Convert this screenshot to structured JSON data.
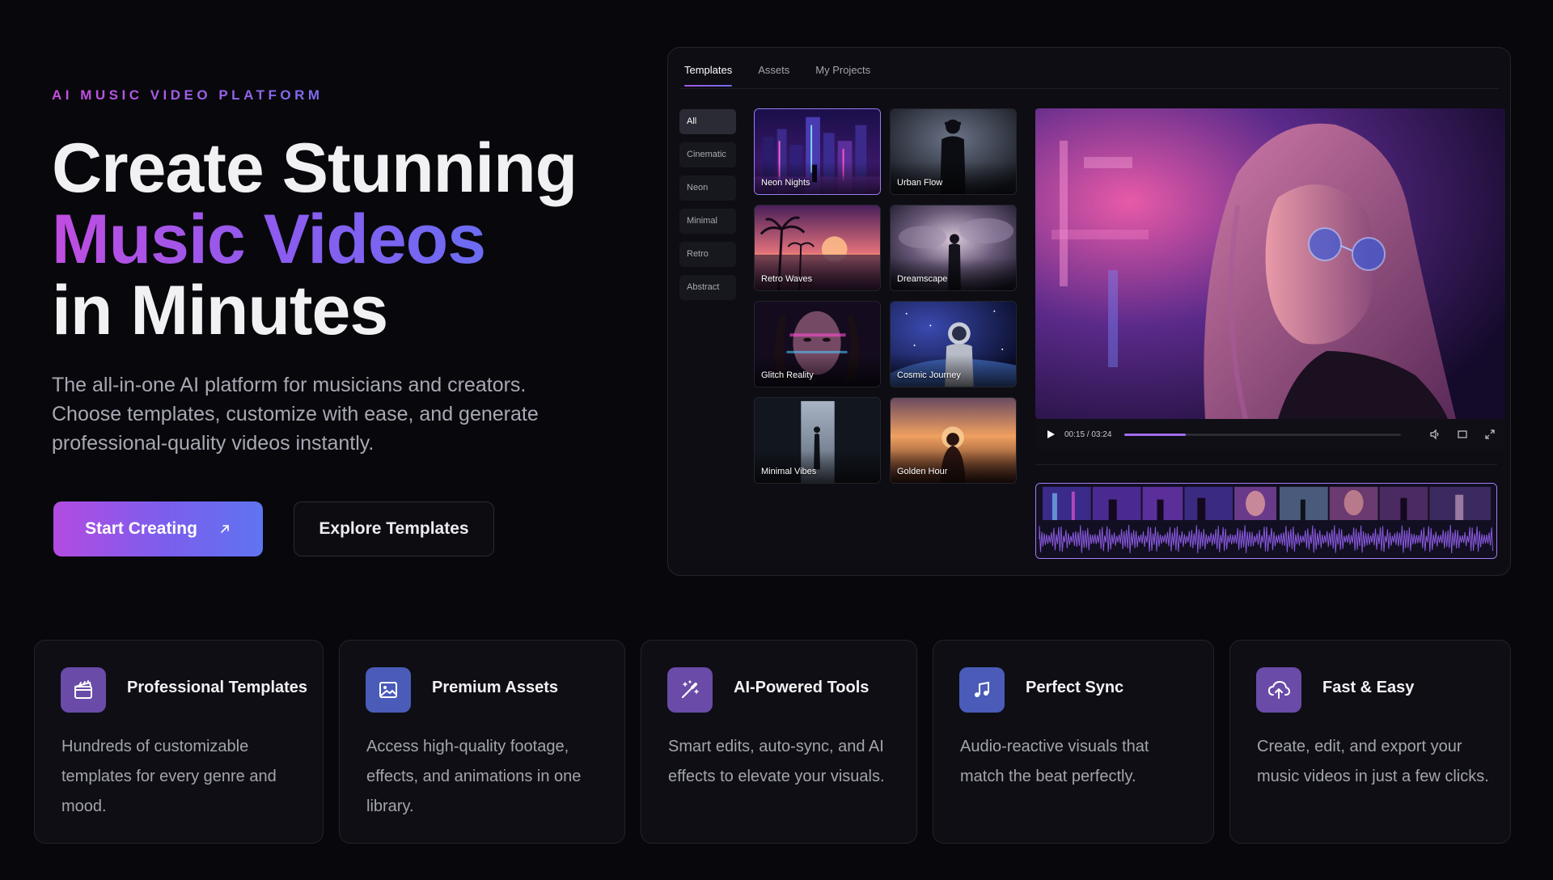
{
  "hero": {
    "eyebrow": "AI MUSIC VIDEO PLATFORM",
    "headline_line1": "Create Stunning",
    "headline_line2": "Music Videos",
    "headline_line3": "in Minutes",
    "subtext": "The all-in-one AI platform for musicians and creators. Choose templates, customize with ease, and generate professional-quality videos instantly.",
    "primary_cta": "Start Creating",
    "secondary_cta": "Explore Templates"
  },
  "app": {
    "tabs": [
      "Templates",
      "Assets",
      "My Projects"
    ],
    "active_tab": "Templates",
    "categories": [
      "All",
      "Cinematic",
      "Neon",
      "Minimal",
      "Retro",
      "Abstract"
    ],
    "active_category": "All",
    "templates": [
      {
        "label": "Neon Nights",
        "scene": "city-neon",
        "selected": true
      },
      {
        "label": "Urban Flow",
        "scene": "man-mist",
        "selected": false
      },
      {
        "label": "Retro Waves",
        "scene": "sunset-palms",
        "selected": false
      },
      {
        "label": "Dreamscape",
        "scene": "cloud-figure",
        "selected": false
      },
      {
        "label": "Glitch Reality",
        "scene": "glitch-face",
        "selected": false
      },
      {
        "label": "Cosmic Journey",
        "scene": "astronaut",
        "selected": false
      },
      {
        "label": "Minimal Vibes",
        "scene": "door-light",
        "selected": false
      },
      {
        "label": "Golden Hour",
        "scene": "golden-figure",
        "selected": false
      }
    ],
    "player": {
      "time": "00:15 / 03:24",
      "progress": 0.22,
      "icons": [
        "play-icon",
        "volume-icon",
        "screen-icon",
        "fullscreen-icon"
      ]
    }
  },
  "features": [
    {
      "title": "Professional Templates",
      "desc": "Hundreds of customizable templates for every genre and mood.",
      "icon": "clapperboard-icon",
      "color": "#6a4ba8"
    },
    {
      "title": "Premium Assets",
      "desc": "Access high-quality footage, effects, and animations in one library.",
      "icon": "image-icon",
      "color": "#4a5cb8"
    },
    {
      "title": "AI-Powered Tools",
      "desc": "Smart edits, auto-sync, and AI effects to elevate your visuals.",
      "icon": "magic-wand-icon",
      "color": "#6a4ba8"
    },
    {
      "title": "Perfect Sync",
      "desc": "Audio-reactive visuals that match the beat perfectly.",
      "icon": "music-note-icon",
      "color": "#4a5cb8"
    },
    {
      "title": "Fast & Easy",
      "desc": "Create, edit, and export your music videos in just a few clicks.",
      "icon": "cloud-upload-icon",
      "color": "#6a4ba8"
    }
  ]
}
